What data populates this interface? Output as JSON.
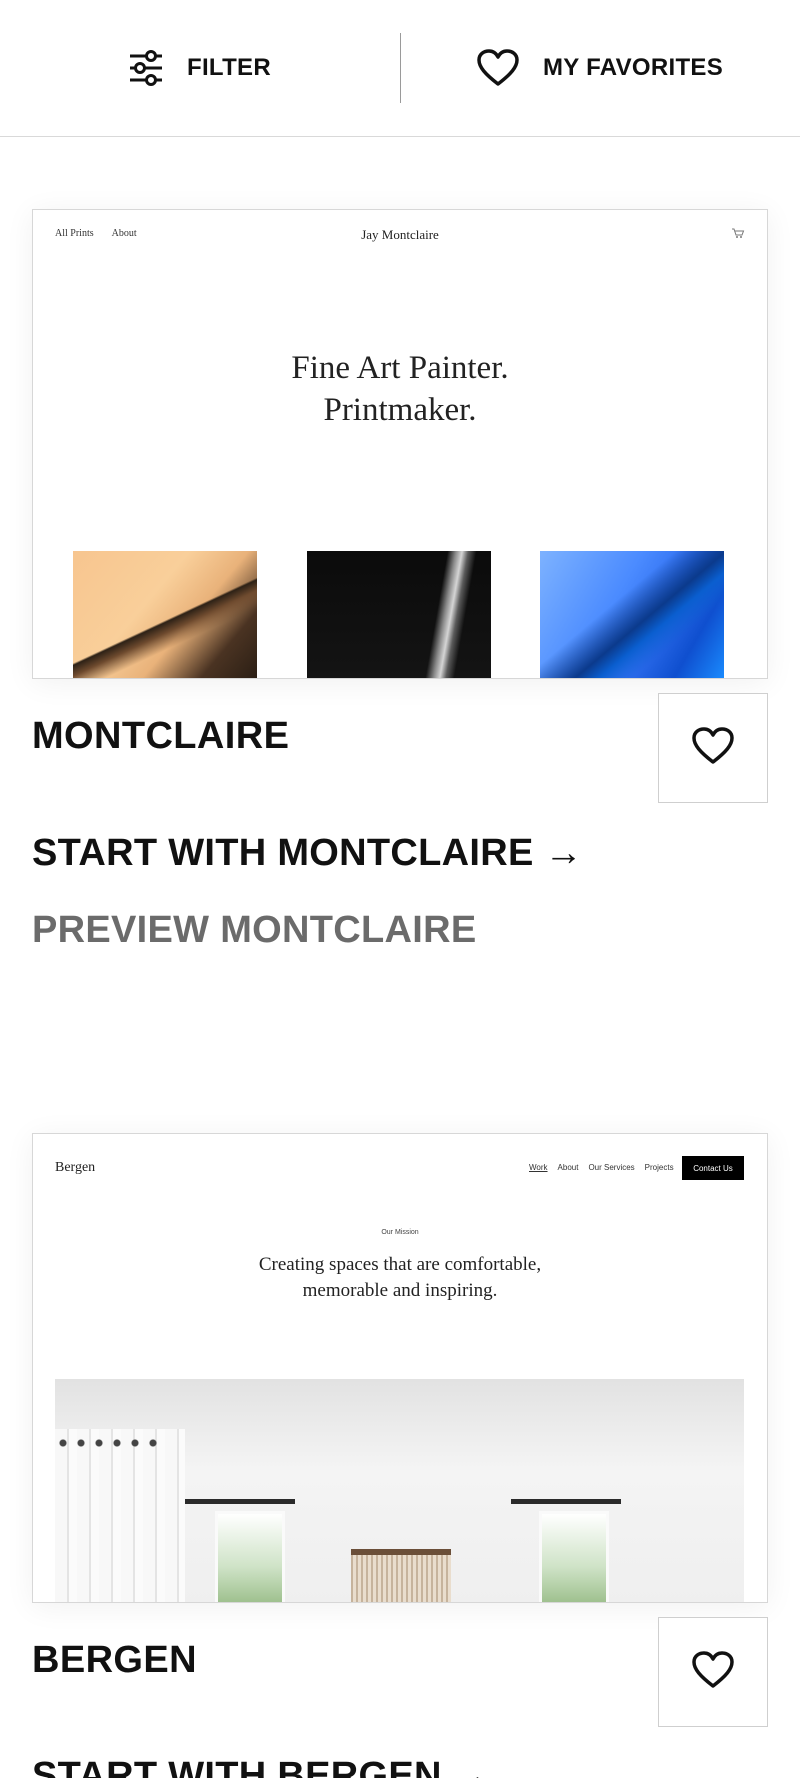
{
  "topbar": {
    "filter_label": "FILTER",
    "favorites_label": "MY FAVORITES"
  },
  "templates": [
    {
      "name": "MONTCLAIRE",
      "start_label": "START WITH MONTCLAIRE →",
      "preview_label": "PREVIEW MONTCLAIRE",
      "preview": {
        "nav": [
          "All Prints",
          "About"
        ],
        "brand": "Jay Montclaire",
        "hero_line1": "Fine Art Painter.",
        "hero_line2": "Printmaker."
      }
    },
    {
      "name": "BERGEN",
      "start_label": "START WITH BERGEN →",
      "preview": {
        "brand": "Bergen",
        "nav": [
          "Work",
          "About",
          "Our Services",
          "Projects"
        ],
        "contact": "Contact Us",
        "kicker": "Our Mission",
        "hero_line1": "Creating spaces that are comfortable,",
        "hero_line2": "memorable and inspiring."
      }
    }
  ],
  "icons": {
    "filter": "sliders-icon",
    "favorites": "heart-outline-icon",
    "favorite_toggle": "heart-outline-icon",
    "cart": "cart-icon"
  }
}
